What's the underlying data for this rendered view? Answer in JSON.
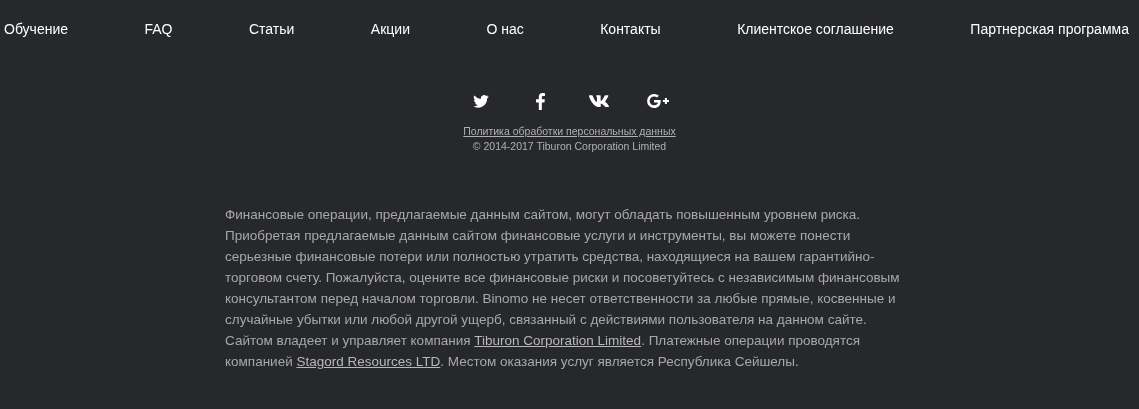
{
  "nav": [
    {
      "label": "Обучение"
    },
    {
      "label": "FAQ"
    },
    {
      "label": "Статьи"
    },
    {
      "label": "Акции"
    },
    {
      "label": "О нас"
    },
    {
      "label": "Контакты"
    },
    {
      "label": "Клиентское соглашение"
    },
    {
      "label": "Партнерская программа"
    }
  ],
  "social": [
    {
      "kind": "twitter"
    },
    {
      "kind": "facebook"
    },
    {
      "kind": "vk"
    },
    {
      "kind": "googleplus"
    }
  ],
  "privacy_link": "Политика обработки персональных данных",
  "copyright": "© 2014-2017 Tiburon Corporation Limited",
  "disclaimer": [
    {
      "kind": "text",
      "text": "Финансовые операции, предлагаемые данным сайтом, могут обладать повышенным уровнем риска. Приобретая предлагаемые данным сайтом финансовые услуги и инструменты, вы можете понести серьезные финансовые потери или полностью утратить средства, находящиеся на вашем гарантийно-торговом счету. Пожалуйста, оцените все финансовые риски и посоветуйтесь с независимым финансовым консультантом перед началом торговли. Binomo не несет ответственности за любые прямые, косвенные и случайные убытки или любой другой ущерб, связанный с действиями пользователя на данном сайте. Сайтом владеет и управляет компания "
    },
    {
      "kind": "link",
      "text": "Tiburon Corporation Limited"
    },
    {
      "kind": "text",
      "text": ". Платежные операции проводятся компанией "
    },
    {
      "kind": "link",
      "text": "Stagord Resources LTD"
    },
    {
      "kind": "text",
      "text": ". Местом оказания услуг является Республика Сейшелы."
    }
  ]
}
